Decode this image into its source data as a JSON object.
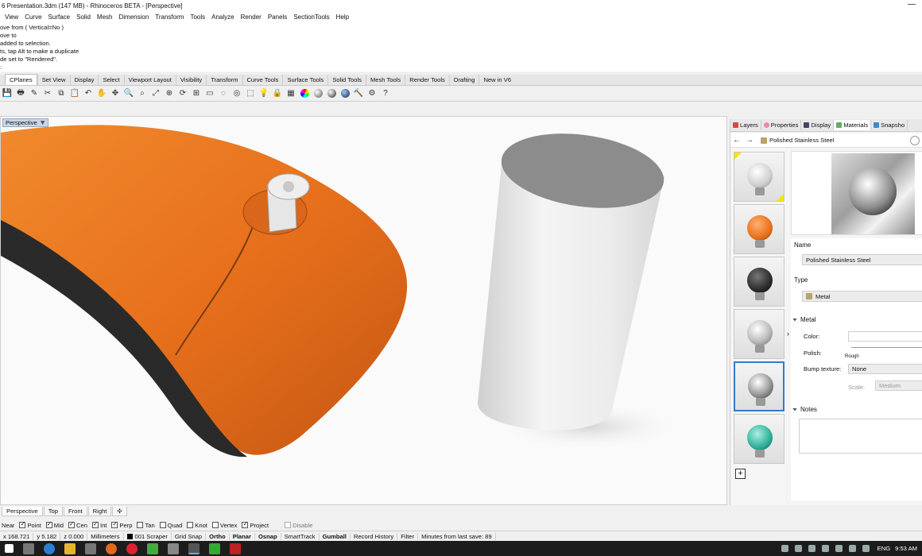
{
  "window": {
    "title": "6 Presentation.3dm (147 MB) - Rhinoceros BETA - [Perspective]",
    "minimize": "—"
  },
  "menu": [
    "View",
    "Curve",
    "Surface",
    "Solid",
    "Mesh",
    "Dimension",
    "Transform",
    "Tools",
    "Analyze",
    "Render",
    "Panels",
    "SectionTools",
    "Help"
  ],
  "command_history": [
    "ove from ( Vertical=No )",
    "ove to",
    " added to selection.",
    "ts, tap Alt to make a duplicate",
    "de set to \"Rendered\".",
    ":"
  ],
  "toolbar_tabs": [
    "CPlanes",
    "Set View",
    "Display",
    "Select",
    "Viewport Layout",
    "Visibility",
    "Transform",
    "Curve Tools",
    "Surface Tools",
    "Solid Tools",
    "Mesh Tools",
    "Render Tools",
    "Drafting",
    "New in V6"
  ],
  "toolbar_icons": [
    {
      "name": "save-icon",
      "glyph": "💾"
    },
    {
      "name": "print-icon",
      "glyph": "🖶"
    },
    {
      "name": "properties-icon",
      "glyph": "✎"
    },
    {
      "name": "cut-icon",
      "glyph": "✂"
    },
    {
      "name": "copy-icon",
      "glyph": "⧉"
    },
    {
      "name": "paste-icon",
      "glyph": "📋"
    },
    {
      "name": "undo-icon",
      "glyph": "↶"
    },
    {
      "name": "pan-icon",
      "glyph": "✋"
    },
    {
      "name": "move-icon",
      "glyph": "✥"
    },
    {
      "name": "zoom-icon",
      "glyph": "🔍"
    },
    {
      "name": "zoom-window-icon",
      "glyph": "⌕"
    },
    {
      "name": "zoom-extents-icon",
      "glyph": "⤢"
    },
    {
      "name": "zoom-selected-icon",
      "glyph": "⊕"
    },
    {
      "name": "rotate-view-icon",
      "glyph": "⟳"
    },
    {
      "name": "four-viewports-icon",
      "glyph": "⊞"
    },
    {
      "name": "cplane-icon",
      "glyph": "▭"
    },
    {
      "name": "show-objects-icon",
      "glyph": "◌"
    },
    {
      "name": "osnap-icon",
      "glyph": "◎"
    },
    {
      "name": "select-icon",
      "glyph": "⬚"
    },
    {
      "name": "light-icon",
      "glyph": "💡"
    },
    {
      "name": "lock-icon",
      "glyph": "🔒"
    },
    {
      "name": "layer-icon",
      "glyph": "▦"
    },
    {
      "name": "color-wheel-icon",
      "glyph": "●"
    },
    {
      "name": "shaded-icon",
      "glyph": "●"
    },
    {
      "name": "rendered-icon",
      "glyph": "●"
    },
    {
      "name": "material-icon",
      "glyph": "●"
    },
    {
      "name": "render-icon",
      "glyph": "🔨"
    },
    {
      "name": "options-icon",
      "glyph": "⚙"
    },
    {
      "name": "help-icon",
      "glyph": "?"
    }
  ],
  "viewport": {
    "label": "Perspective"
  },
  "viewport_tabs": [
    "Perspective",
    "Top",
    "Front",
    "Right",
    "✣"
  ],
  "osnap": [
    {
      "label": "Near",
      "checked": false
    },
    {
      "label": "Point",
      "checked": true
    },
    {
      "label": "Mid",
      "checked": true
    },
    {
      "label": "Cen",
      "checked": true
    },
    {
      "label": "Int",
      "checked": true
    },
    {
      "label": "Perp",
      "checked": true
    },
    {
      "label": "Tan",
      "checked": false
    },
    {
      "label": "Quad",
      "checked": false
    },
    {
      "label": "Knot",
      "checked": false
    },
    {
      "label": "Vertex",
      "checked": false
    },
    {
      "label": "Project",
      "checked": true
    },
    {
      "label": "Disable",
      "checked": false
    }
  ],
  "status": {
    "x": "x 168.721",
    "y": "y 5.182",
    "z": "z 0.000",
    "units": "Millimeters",
    "layer": "001 Scraper",
    "grid_snap": "Grid Snap",
    "ortho": "Ortho",
    "planar": "Planar",
    "osnap": "Osnap",
    "smarttrack": "SmartTrack",
    "gumball": "Gumball",
    "record_history": "Record History",
    "filter": "Filter",
    "save_info": "Minutes from last save: 89"
  },
  "taskbar": {
    "lang": "ENG",
    "time": "9:53 AM"
  },
  "panel": {
    "tabs": [
      "Layers",
      "Properties",
      "Display",
      "Materials",
      "Snapsho"
    ],
    "back": "←",
    "forward": "→",
    "material_name": "Polished Stainless Steel",
    "name_label": "Name",
    "name_value": "Polished Stainless Steel",
    "type_label": "Type",
    "type_value": "Metal",
    "metal_section": "Metal",
    "color_label": "Color:",
    "polish_label": "Polish:",
    "rough_label": "Rough",
    "bump_label": "Bump texture:",
    "bump_value": "None",
    "scale_label": "Scale:",
    "scale_value": "Medium",
    "notes_section": "Notes",
    "add_button": "+",
    "collapse_arrow": "›"
  },
  "colors": {
    "accent": "#3a78c9",
    "orange": "#e8701c",
    "selection_corner": "#f2e600"
  }
}
